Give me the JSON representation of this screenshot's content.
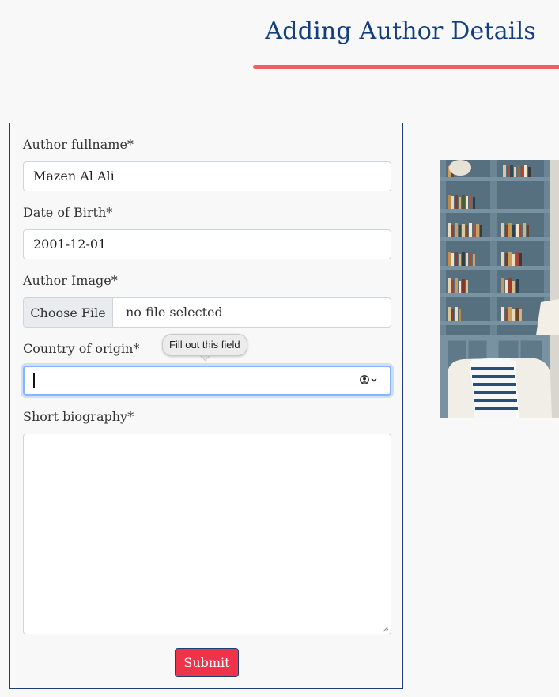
{
  "page": {
    "title": "Adding Author Details"
  },
  "form": {
    "fullname": {
      "label": "Author fullname*",
      "value": "Mazen Al Ali"
    },
    "dob": {
      "label": "Date of Birth*",
      "value": "2001-12-01"
    },
    "image": {
      "label": "Author Image*",
      "button_label": "Choose File",
      "status": "no file selected"
    },
    "country": {
      "label": "Country of origin*",
      "value": "",
      "validation_tooltip": "Fill out this field",
      "icon": "autofill-contact-icon"
    },
    "biography": {
      "label": "Short biography*",
      "value": ""
    },
    "submit_label": "Submit"
  },
  "colors": {
    "title": "#123f7e",
    "accent_underline": "#f0605f",
    "submit_bg": "#f0324b",
    "card_border": "#1c3f77",
    "focus_ring": "#86b7fe"
  },
  "image": {
    "subject": "bookshelf-with-armchair-photo"
  }
}
